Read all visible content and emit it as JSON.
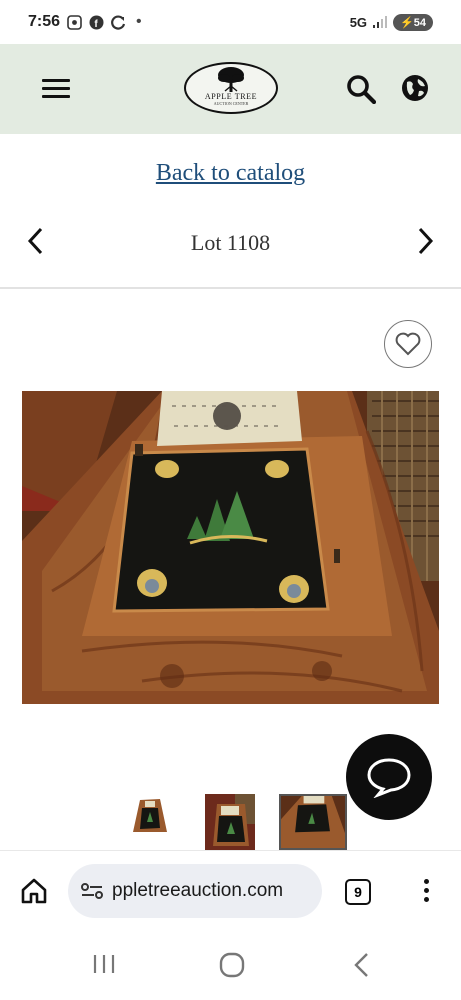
{
  "status_bar": {
    "time": "7:56",
    "network": "5G",
    "battery": "54",
    "icons": [
      "screenshot-icon",
      "facebook-icon",
      "sync-icon",
      "dot-icon",
      "signal-icon",
      "battery-charging-icon"
    ]
  },
  "header": {
    "logo_name": "APPLE TREE",
    "logo_sub": "AUCTION CENTER",
    "bg_color": "#e3ebe1"
  },
  "nav": {
    "back_link": "Back to catalog",
    "lot_title": "Lot 1108",
    "link_color": "#1f4e7a"
  },
  "gallery": {
    "photo_subject": "ogee-clock-photo",
    "thumbnail_count": 3,
    "selected_thumbnail": 3
  },
  "browser": {
    "url": "ppletreeauction.com",
    "tab_count": "9"
  }
}
